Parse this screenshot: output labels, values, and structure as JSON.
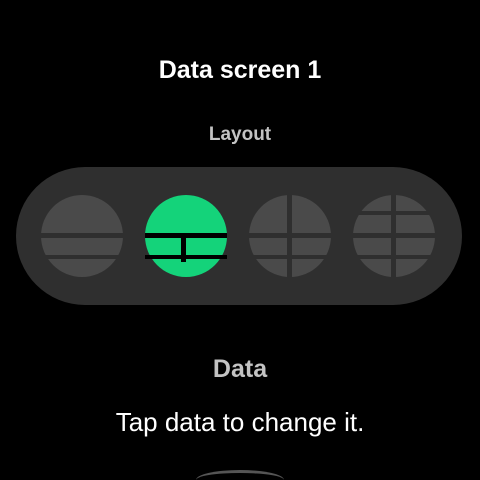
{
  "screen": {
    "title": "Data screen 1"
  },
  "layout_section": {
    "label": "Layout",
    "options": [
      {
        "icon": "layout-two-rows-icon",
        "selected": false
      },
      {
        "icon": "layout-row-and-two-cells-icon",
        "selected": true
      },
      {
        "icon": "layout-four-quadrants-icon",
        "selected": false
      },
      {
        "icon": "layout-top-row-quadrants-bottom-icon",
        "selected": false
      }
    ]
  },
  "data_section": {
    "heading": "Data",
    "hint": "Tap data to change it."
  },
  "colors": {
    "background": "#000000",
    "picker_track": "#2f2f2f",
    "option_idle": "#4a4a4a",
    "option_selected": "#14d37a",
    "divider_idle": "#2f2f2f",
    "divider_selected": "#000000",
    "secondary_text": "#c3c3c3",
    "primary_text": "#ffffff"
  }
}
